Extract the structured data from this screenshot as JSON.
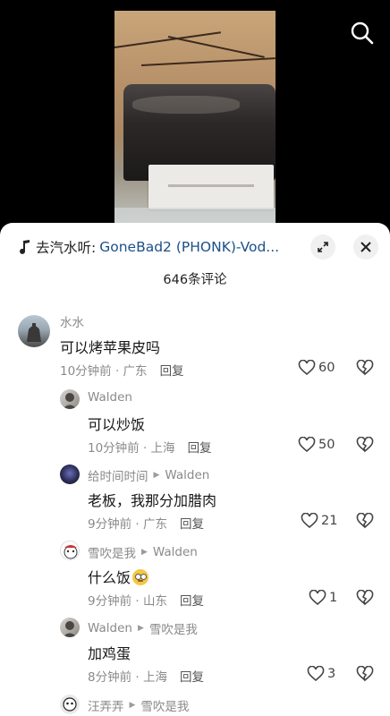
{
  "video": {
    "icons": {
      "search": "search-icon"
    }
  },
  "sheet": {
    "music_prefix": "去汽水听:",
    "music_title": "GoneBad2 (PHONK)-Vod...",
    "comment_count": "646条评论",
    "icons": {
      "music": "music-note-icon",
      "collapse": "collapse-icon",
      "close": "close-icon"
    }
  },
  "comments": [
    {
      "user": "水水",
      "reply_to": "",
      "text": "可以烤苹果皮吗",
      "emoji": "",
      "time": "10分钟前 · 广东",
      "reply": "回复",
      "likes": "60"
    },
    {
      "user": "Walden",
      "reply_to": "",
      "text": "可以炒饭",
      "emoji": "",
      "time": "10分钟前 · 上海",
      "reply": "回复",
      "likes": "50"
    },
    {
      "user": "给时间时间",
      "reply_to": "Walden",
      "text": "老板，我那分加腊肉",
      "emoji": "",
      "time": "9分钟前 · 广东",
      "reply": "回复",
      "likes": "21"
    },
    {
      "user": "雪吹是我",
      "reply_to": "Walden",
      "text": "什么饭",
      "emoji": "eye-roll-emoji",
      "time": "9分钟前 · 山东",
      "reply": "回复",
      "likes": "1"
    },
    {
      "user": "Walden",
      "reply_to": "雪吹是我",
      "text": "加鸡蛋",
      "emoji": "",
      "time": "8分钟前 · 上海",
      "reply": "回复",
      "likes": "3"
    },
    {
      "user": "汪弄弄",
      "reply_to": "雪吹是我",
      "text": "",
      "emoji": "",
      "time": "",
      "reply": "",
      "likes": ""
    }
  ],
  "colors": {
    "link": "#1b4f8a",
    "muted": "#8a8a8a",
    "text": "#161616"
  }
}
